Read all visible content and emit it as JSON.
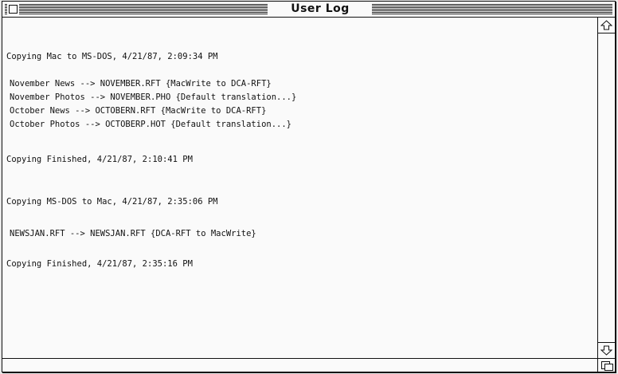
{
  "window": {
    "title": "User Log"
  },
  "log": {
    "lines": [
      "Copying Mac to MS-DOS, 4/21/87, 2:09:34 PM",
      "November News --> NOVEMBER.RFT {MacWrite to DCA-RFT}",
      "November Photos --> NOVEMBER.PHO {Default translation...}",
      "October News --> OCTOBERN.RFT {MacWrite to DCA-RFT}",
      "October Photos --> OCTOBERP.HOT {Default translation...}",
      "Copying Finished, 4/21/87, 2:10:41 PM",
      "Copying MS-DOS to Mac, 4/21/87, 2:35:06 PM",
      "NEWSJAN.RFT --> NEWSJAN.RFT {DCA-RFT to MacWrite}",
      "Copying Finished, 4/21/87, 2:35:16 PM"
    ]
  },
  "icons": {
    "close": "close-box-icon",
    "scroll_up": "up-arrow-icon",
    "scroll_down": "down-arrow-icon",
    "grow": "grow-box-icon"
  }
}
